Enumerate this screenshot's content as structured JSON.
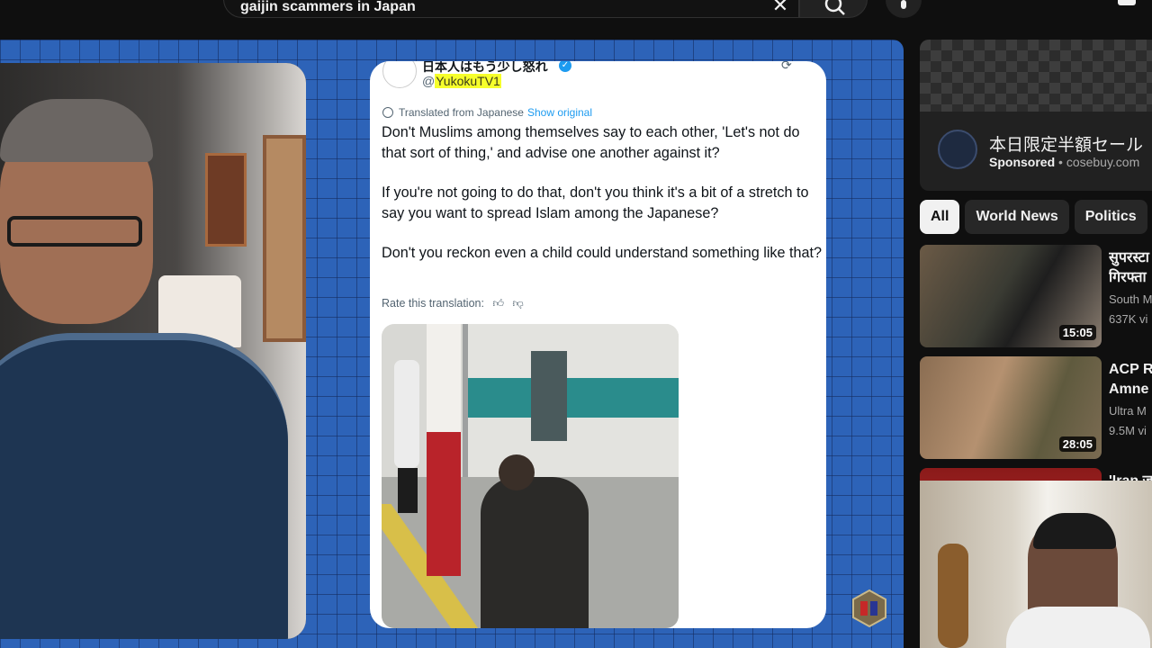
{
  "search": {
    "query": "gaijin scammers in Japan"
  },
  "tweet": {
    "account_name": "日本人はもう少し怒れ",
    "handle_prefix": "@",
    "handle": "YukokuTV1",
    "translated_label": "Translated from Japanese",
    "show_original": "Show original",
    "paragraphs": [
      "Don't Muslims among themselves say to each other, 'Let's not do that sort of thing,' and advise one another against it?",
      "If you're not going to do that, don't you think it's a bit of a stretch to say you want to spread Islam among the Japanese?",
      "Don't you reckon even a child could understand something like that?"
    ],
    "rate_label": "Rate this translation:"
  },
  "ad": {
    "title": "本日限定半額セール",
    "sponsored": "Sponsored",
    "separator": " • ",
    "domain": "cosebuy.com"
  },
  "chips": [
    "All",
    "World News",
    "Politics"
  ],
  "recommendations": [
    {
      "title_line1": "सुपरस्टा",
      "title_line2": "गिरफ्ता",
      "meta_line1": "South M",
      "meta_line2": "637K vi",
      "duration": "15:05"
    },
    {
      "title_line1": "ACP R",
      "title_line2": "Amne",
      "meta_line1": "Ultra M",
      "meta_line2": "9.5M vi",
      "duration": "28:05"
    },
    {
      "title_line1": "'Iran ज",
      "title_line2": "",
      "meta_line1": "",
      "meta_line2": "",
      "duration": ""
    }
  ],
  "colors": {
    "player_bg": "#2d63b8",
    "highlight": "#f6ff2b",
    "link": "#1d9bf0"
  }
}
